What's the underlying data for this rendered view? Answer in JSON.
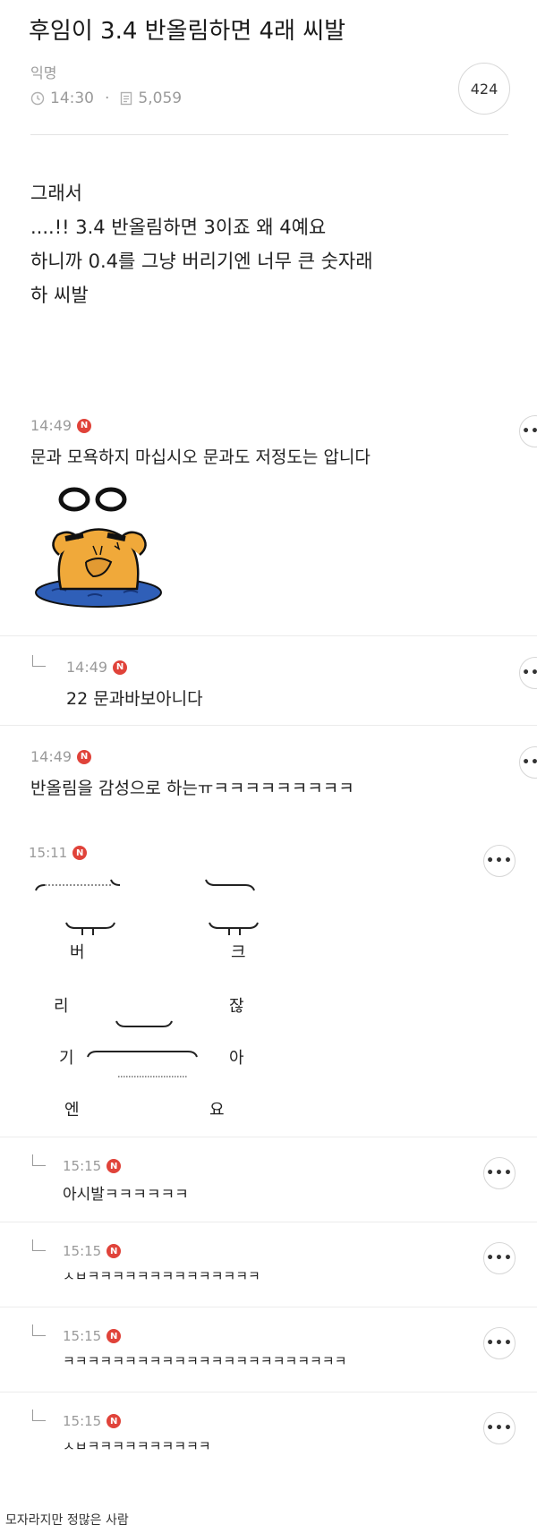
{
  "post": {
    "title": "후임이 3.4 반올림하면 4래 씨발",
    "author": "익명",
    "time": "14:30",
    "views": "5,059",
    "comment_count": "424",
    "body": [
      "그래서",
      "....!! 3.4 반올림하면 3이죠 왜 4예요",
      "하니까 0.4를 그냥 버리기엔 너무 큰 숫자래",
      "하 씨발"
    ]
  },
  "comments": [
    {
      "time": "14:49",
      "badge": "N",
      "text": "문과 모욕하지 마십시오 문과도 저정도는 압니다"
    },
    {
      "time": "14:49",
      "badge": "N",
      "text": "22 문과바보아니다"
    },
    {
      "time": "14:49",
      "badge": "N",
      "text": "반올림을 감성으로 하는ㅠㅋㅋㅋㅋㅋㅋㅋㅋㅋ"
    },
    {
      "time": "15:11",
      "badge": "N",
      "art": {
        "c1": "버",
        "c2": "리",
        "c3": "기",
        "c4": "엔",
        "c5": "크",
        "c6": "잖",
        "c7": "아",
        "c8": "요"
      }
    },
    {
      "time": "15:15",
      "badge": "N",
      "text": "아시발ㅋㅋㅋㅋㅋㅋ"
    },
    {
      "time": "15:15",
      "badge": "N",
      "text": "ㅅㅂㅋㅋㅋㅋㅋㅋㅋㅋㅋㅋㅋㅋㅋㅋ"
    },
    {
      "time": "15:15",
      "badge": "N",
      "text": "ㅋㅋㅋㅋㅋㅋㅋㅋㅋㅋㅋㅋㅋㅋㅋㅋㅋㅋㅋㅋㅋㅋㅋ"
    },
    {
      "time": "15:15",
      "badge": "N",
      "text": "ㅅㅂㅋㅋㅋㅋㅋㅋㅋㅋㅋㅋ"
    }
  ],
  "ui": {
    "more_label": "•••",
    "caption": "모자라지만 정많은 사람"
  },
  "colors": {
    "badge": "#e0433a",
    "meta_gray": "#9a9a9a",
    "divider": "#e3e3e3"
  },
  "icons": [
    "clock-icon",
    "document-icon",
    "reply-arrow-icon",
    "more-icon",
    "frog-sticker"
  ]
}
